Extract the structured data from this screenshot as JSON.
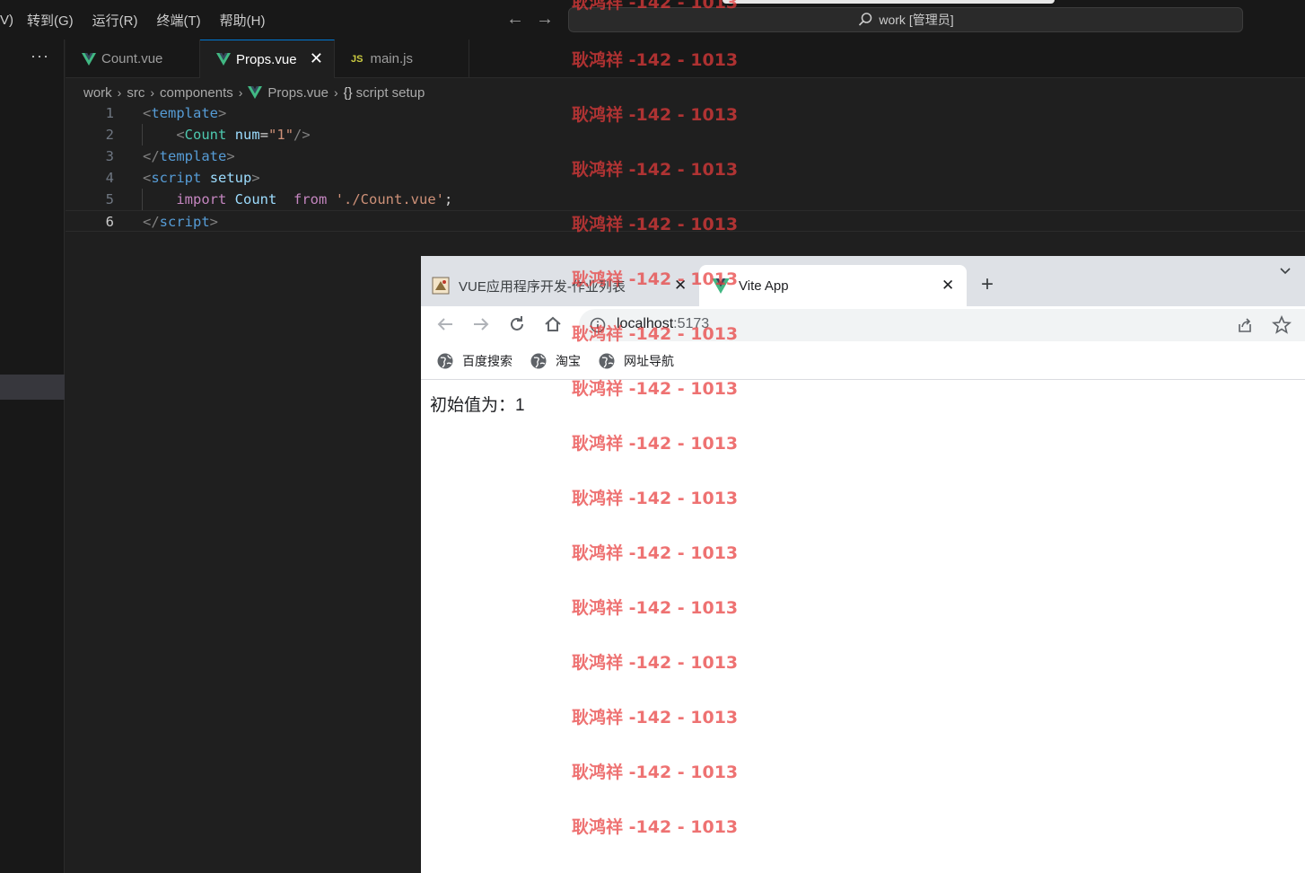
{
  "vscode": {
    "menu": [
      "V)",
      "转到(G)",
      "运行(R)",
      "终端(T)",
      "帮助(H)"
    ],
    "command_center": "work [管理员]",
    "tabs": [
      {
        "label": "Count.vue",
        "icon": "vue-icon"
      },
      {
        "label": "Props.vue",
        "icon": "vue-icon",
        "active": true
      },
      {
        "label": "main.js",
        "icon": "js-icon",
        "icon_text": "JS"
      }
    ],
    "breadcrumb": [
      "work",
      "src",
      "components",
      "Props.vue",
      "script setup"
    ],
    "breadcrumb_braces": "{}",
    "line_numbers": [
      "1",
      "2",
      "3",
      "4",
      "5",
      "6"
    ],
    "code": {
      "l1": {
        "open": "<",
        "tag": "template",
        "close": ">"
      },
      "l2": {
        "open": "<",
        "comp": "Count",
        "attr": "num",
        "eq": "=",
        "val": "\"1\"",
        "close": "/>"
      },
      "l3": {
        "open": "</",
        "tag": "template",
        "close": ">"
      },
      "l4": {
        "open": "<",
        "tag": "script",
        "attr": "setup",
        "close": ">"
      },
      "l5": {
        "kw1": "import",
        "name": "Count",
        "kw2": "from",
        "str": "'./Count.vue'",
        "semi": ";"
      },
      "l6": {
        "open": "</",
        "tag": "script",
        "close": ">"
      }
    },
    "colors": {
      "accent": "#0078d4",
      "vue_green": "#41b883",
      "js_yellow": "#cbcb41"
    }
  },
  "browser": {
    "tabs": [
      {
        "title": "VUE应用程序开发-作业列表",
        "icon": "vue-app-favicon"
      },
      {
        "title": "Vite App",
        "icon": "vue-icon",
        "active": true
      }
    ],
    "address": {
      "host": "localhost",
      "port": ":5173"
    },
    "bookmarks": [
      "百度搜索",
      "淘宝",
      "网址导航"
    ],
    "page": {
      "text": "初始值为：1"
    }
  },
  "watermark": {
    "text": "耿鸿祥 -142 - 1013"
  }
}
